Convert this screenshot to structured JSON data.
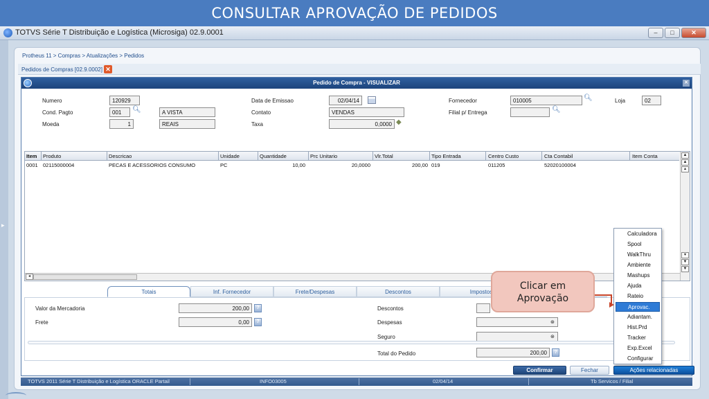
{
  "banner": {
    "title": "CONSULTAR APROVAÇÃO DE PEDIDOS"
  },
  "window": {
    "title": "TOTVS Série T Distribuição e Logística (Microsiga) 02.9.0001"
  },
  "breadcrumb": "Protheus 11 > Compras  > Atualizações > Pedidos",
  "subwindow": {
    "label": "Pedidos de Compras [02.9.0002]"
  },
  "dialog": {
    "title": "Pedido de Compra - VISUALIZAR",
    "fields": {
      "numero": {
        "label": "Numero",
        "value": "120929"
      },
      "cond_pagto": {
        "label": "Cond. Pagto",
        "value": "001",
        "desc": "A VISTA"
      },
      "moeda": {
        "label": "Moeda",
        "value": "1",
        "desc": "REAIS"
      },
      "data_emissao": {
        "label": "Data de Emissao",
        "value": "02/04/14"
      },
      "contato": {
        "label": "Contato",
        "value": "VENDAS"
      },
      "taxa": {
        "label": "Taxa",
        "value": "0,0000"
      },
      "fornecedor": {
        "label": "Fornecedor",
        "value": "010005"
      },
      "loja": {
        "label": "Loja",
        "value": "02"
      },
      "filial_entrega": {
        "label": "Filial p/ Entrega",
        "value": ""
      }
    }
  },
  "grid": {
    "columns": [
      "Item",
      "Produto",
      "Descricao",
      "Unidade",
      "Quantidade",
      "Prc Unitario",
      "Vlr.Total",
      "Tipo Entrada",
      "Centro Custo",
      "Cta Contabil",
      "Item Conta"
    ],
    "rows": [
      [
        "0001",
        "02115000004",
        "PECAS E ACESSORIOS CONSUMO",
        "PC",
        "10,00",
        "20,0000",
        "200,00",
        "019",
        "011205",
        "52020100004",
        ""
      ]
    ]
  },
  "tabs": [
    "Totais",
    "Inf. Fornecedor",
    "Frete/Despesas",
    "Descontos",
    "Impostos"
  ],
  "totais": {
    "valor_mercadoria": {
      "label": "Valor da Mercadoria",
      "value": "200,00"
    },
    "frete": {
      "label": "Frete",
      "value": "0,00"
    },
    "descontos": {
      "label": "Descontos",
      "value": ""
    },
    "despesas": {
      "label": "Despesas",
      "value": ""
    },
    "seguro": {
      "label": "Seguro",
      "value": ""
    },
    "total_pedido": {
      "label": "Total do Pedido",
      "value": "200,00"
    }
  },
  "buttons": {
    "confirmar": "Confirmar",
    "fechar": "Fechar",
    "acoes": "Ações relacionadas"
  },
  "menu": [
    "Calculadora",
    "Spool",
    "WalkThru",
    "Ambiente",
    "Mashups",
    "Ajuda",
    "Rateio",
    "Aprovac.",
    "Adiantam.",
    "Hist.Prd",
    "Tracker",
    "Exp.Excel",
    "Configurar"
  ],
  "menu_highlight": "Aprovac.",
  "callout": {
    "line1": "Clicar em",
    "line2": "Aprovação"
  },
  "statusbar": [
    "TOTVS 2011 Série T Distribuição e Logística ORACLE Partail",
    "INFO03005",
    "02/04/14",
    "Tb Servicos / Filial"
  ],
  "colors": {
    "banner": "#4a7cc0",
    "highlight": "#2e7bd6",
    "callout": "#f2c7be",
    "arrow": "#c7452a"
  }
}
